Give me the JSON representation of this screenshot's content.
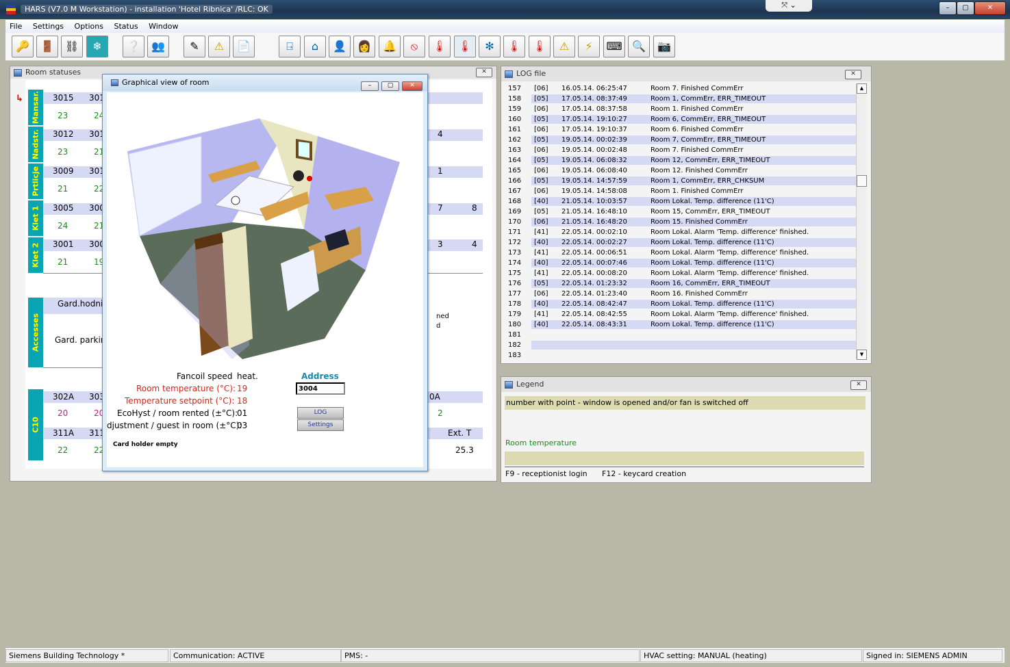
{
  "window": {
    "title": "HARS (V7.0 M Workstation) - installation 'Hotel Ribnica' /RLC: OK",
    "minimize_icon": "minimize-icon",
    "maximize_icon": "maximize-icon",
    "close_icon": "close-icon"
  },
  "menu": [
    "File",
    "Settings",
    "Options",
    "Status",
    "Window"
  ],
  "toolbar": {
    "icons": [
      "keys-person-icon",
      "door-person-icon",
      "network-icon",
      "snowflake-icon",
      "help-key-icon",
      "group-icon",
      "pencil-icon",
      "warning-sign-icon",
      "document-icon",
      "open-door-icon",
      "building-icon",
      "receptionist-icon",
      "maid-icon",
      "bell-icon",
      "no-entry-icon",
      "thermostat-icon",
      "thermometer-icon",
      "fan-icon",
      "thermostat-wc-icon",
      "thermometer-wc-icon",
      "alarm-thermometer-icon",
      "lightning-warning-icon",
      "keyboard-icon",
      "key-search-icon",
      "camera-icon"
    ]
  },
  "room_statuses": {
    "title": "Room statuses",
    "groups": [
      {
        "label": "Mansar.",
        "room": "3015",
        "room2": "301",
        "t1": "23",
        "t2": "24"
      },
      {
        "label": "Nadstr.",
        "room": "3012",
        "room2": "301",
        "t1": "23",
        "t2": "21",
        "right_num": "4"
      },
      {
        "label": "Prtlicje",
        "room": "3009",
        "room2": "301",
        "t1": "21",
        "t2": "22",
        "right_num": "1"
      },
      {
        "label": "Klet 1",
        "room": "3005",
        "room2": "300",
        "t1": "24",
        "t2": "21",
        "right_num": "7",
        "right_num2": "8"
      },
      {
        "label": "Klet 2",
        "room": "3001",
        "room2": "300",
        "t1": "21",
        "t2": "19",
        "right_num": "3",
        "right_num2": "4"
      }
    ],
    "accesses_label": "Accesses",
    "accesses": [
      "Gard.hodnik",
      "Gard. parking"
    ],
    "accesses_right": [
      "ned",
      "d"
    ],
    "c10_label": "C10",
    "c10_rooms": [
      {
        "room": "302A",
        "room2": "303",
        "t1": "20",
        "t2": "20",
        "right": "0A",
        "right2": "2"
      },
      {
        "room": "311A",
        "room2": "311",
        "t1": "22",
        "t2": "22"
      }
    ],
    "ext_label": "Ext. T",
    "ext_value": "25.3"
  },
  "graphical_view": {
    "title": "Graphical view of room",
    "fancoil_label": "Fancoil speed",
    "fancoil_value": "heat.",
    "room_temp_label": "Room temperature (°C):",
    "room_temp_value": "19",
    "setpoint_label": "Temperature setpoint (°C):",
    "setpoint_value": "18",
    "ecohyst_label": "EcoHyst / room rented (±°C):",
    "ecohyst_value": "01",
    "adjustment_label": "djustment / guest in room (±°C):",
    "adjustment_value": "03",
    "card_holder": "Card holder empty",
    "address_label": "Address",
    "address_value": "3004",
    "log_button": "LOG",
    "settings_button": "Settings"
  },
  "log": {
    "title": "LOG file",
    "rows": [
      {
        "n": "157",
        "code": "[06]",
        "time": "16.05.14. 06:25:47",
        "msg": "Room 7. Finished CommErr"
      },
      {
        "n": "158",
        "code": "[05]",
        "time": "17.05.14. 08:37:49",
        "msg": "Room 1, CommErr, ERR_TIMEOUT"
      },
      {
        "n": "159",
        "code": "[06]",
        "time": "17.05.14. 08:37:58",
        "msg": "Room 1. Finished CommErr"
      },
      {
        "n": "160",
        "code": "[05]",
        "time": "17.05.14. 19:10:27",
        "msg": "Room 6, CommErr, ERR_TIMEOUT"
      },
      {
        "n": "161",
        "code": "[06]",
        "time": "17.05.14. 19:10:37",
        "msg": "Room 6. Finished CommErr"
      },
      {
        "n": "162",
        "code": "[05]",
        "time": "19.05.14. 00:02:39",
        "msg": "Room 7, CommErr, ERR_TIMEOUT"
      },
      {
        "n": "163",
        "code": "[06]",
        "time": "19.05.14. 00:02:48",
        "msg": "Room 7. Finished CommErr"
      },
      {
        "n": "164",
        "code": "[05]",
        "time": "19.05.14. 06:08:32",
        "msg": "Room 12, CommErr, ERR_TIMEOUT"
      },
      {
        "n": "165",
        "code": "[06]",
        "time": "19.05.14. 06:08:40",
        "msg": "Room 12. Finished CommErr"
      },
      {
        "n": "166",
        "code": "[05]",
        "time": "19.05.14. 14:57:59",
        "msg": "Room 1, CommErr, ERR_CHKSUM"
      },
      {
        "n": "167",
        "code": "[06]",
        "time": "19.05.14. 14:58:08",
        "msg": "Room 1. Finished CommErr"
      },
      {
        "n": "168",
        "code": "[40]",
        "time": "21.05.14. 10:03:57",
        "msg": "Room Lokal. Temp. difference (11'C)"
      },
      {
        "n": "169",
        "code": "[05]",
        "time": "21.05.14. 16:48:10",
        "msg": "Room 15, CommErr, ERR_TIMEOUT"
      },
      {
        "n": "170",
        "code": "[06]",
        "time": "21.05.14. 16:48:20",
        "msg": "Room 15. Finished CommErr"
      },
      {
        "n": "171",
        "code": "[41]",
        "time": "22.05.14. 00:02:10",
        "msg": "Room Lokal. Alarm 'Temp. difference' finished."
      },
      {
        "n": "172",
        "code": "[40]",
        "time": "22.05.14. 00:02:27",
        "msg": "Room Lokal. Temp. difference (11'C)"
      },
      {
        "n": "173",
        "code": "[41]",
        "time": "22.05.14. 00:06:51",
        "msg": "Room Lokal. Alarm 'Temp. difference' finished."
      },
      {
        "n": "174",
        "code": "[40]",
        "time": "22.05.14. 00:07:46",
        "msg": "Room Lokal. Temp. difference (11'C)"
      },
      {
        "n": "175",
        "code": "[41]",
        "time": "22.05.14. 00:08:20",
        "msg": "Room Lokal. Alarm 'Temp. difference' finished."
      },
      {
        "n": "176",
        "code": "[05]",
        "time": "22.05.14. 01:23:32",
        "msg": "Room 16, CommErr, ERR_TIMEOUT"
      },
      {
        "n": "177",
        "code": "[06]",
        "time": "22.05.14. 01:23:40",
        "msg": "Room 16. Finished CommErr"
      },
      {
        "n": "178",
        "code": "[40]",
        "time": "22.05.14. 08:42:47",
        "msg": "Room Lokal. Temp. difference (11'C)"
      },
      {
        "n": "179",
        "code": "[41]",
        "time": "22.05.14. 08:42:55",
        "msg": "Room Lokal. Alarm 'Temp. difference' finished."
      },
      {
        "n": "180",
        "code": "[40]",
        "time": "22.05.14. 08:43:31",
        "msg": "Room Lokal. Temp. difference (11'C)"
      },
      {
        "n": "181",
        "code": "",
        "time": "",
        "msg": ""
      },
      {
        "n": "182",
        "code": "",
        "time": "",
        "msg": ""
      },
      {
        "n": "183",
        "code": "",
        "time": "",
        "msg": ""
      }
    ]
  },
  "legend": {
    "title": "Legend",
    "line1": "number with point - window is opened and/or fan is switched off",
    "line2": "Room temperature",
    "keys1": "F9 - receptionist login",
    "keys2": "F12 - keycard creation"
  },
  "status_bar": {
    "company": "Siemens Building Technology *",
    "communication": "Communication: ACTIVE",
    "pms": "PMS: -",
    "hvac": "HVAC setting: MANUAL (heating)",
    "signed": "Signed in: SIEMENS ADMIN"
  },
  "colors": {
    "accent": "#0aa4b2",
    "strip": "#d6d9f4",
    "legend": "#dcdab0",
    "red": "#e0201a",
    "green": "#1a8a1a"
  }
}
